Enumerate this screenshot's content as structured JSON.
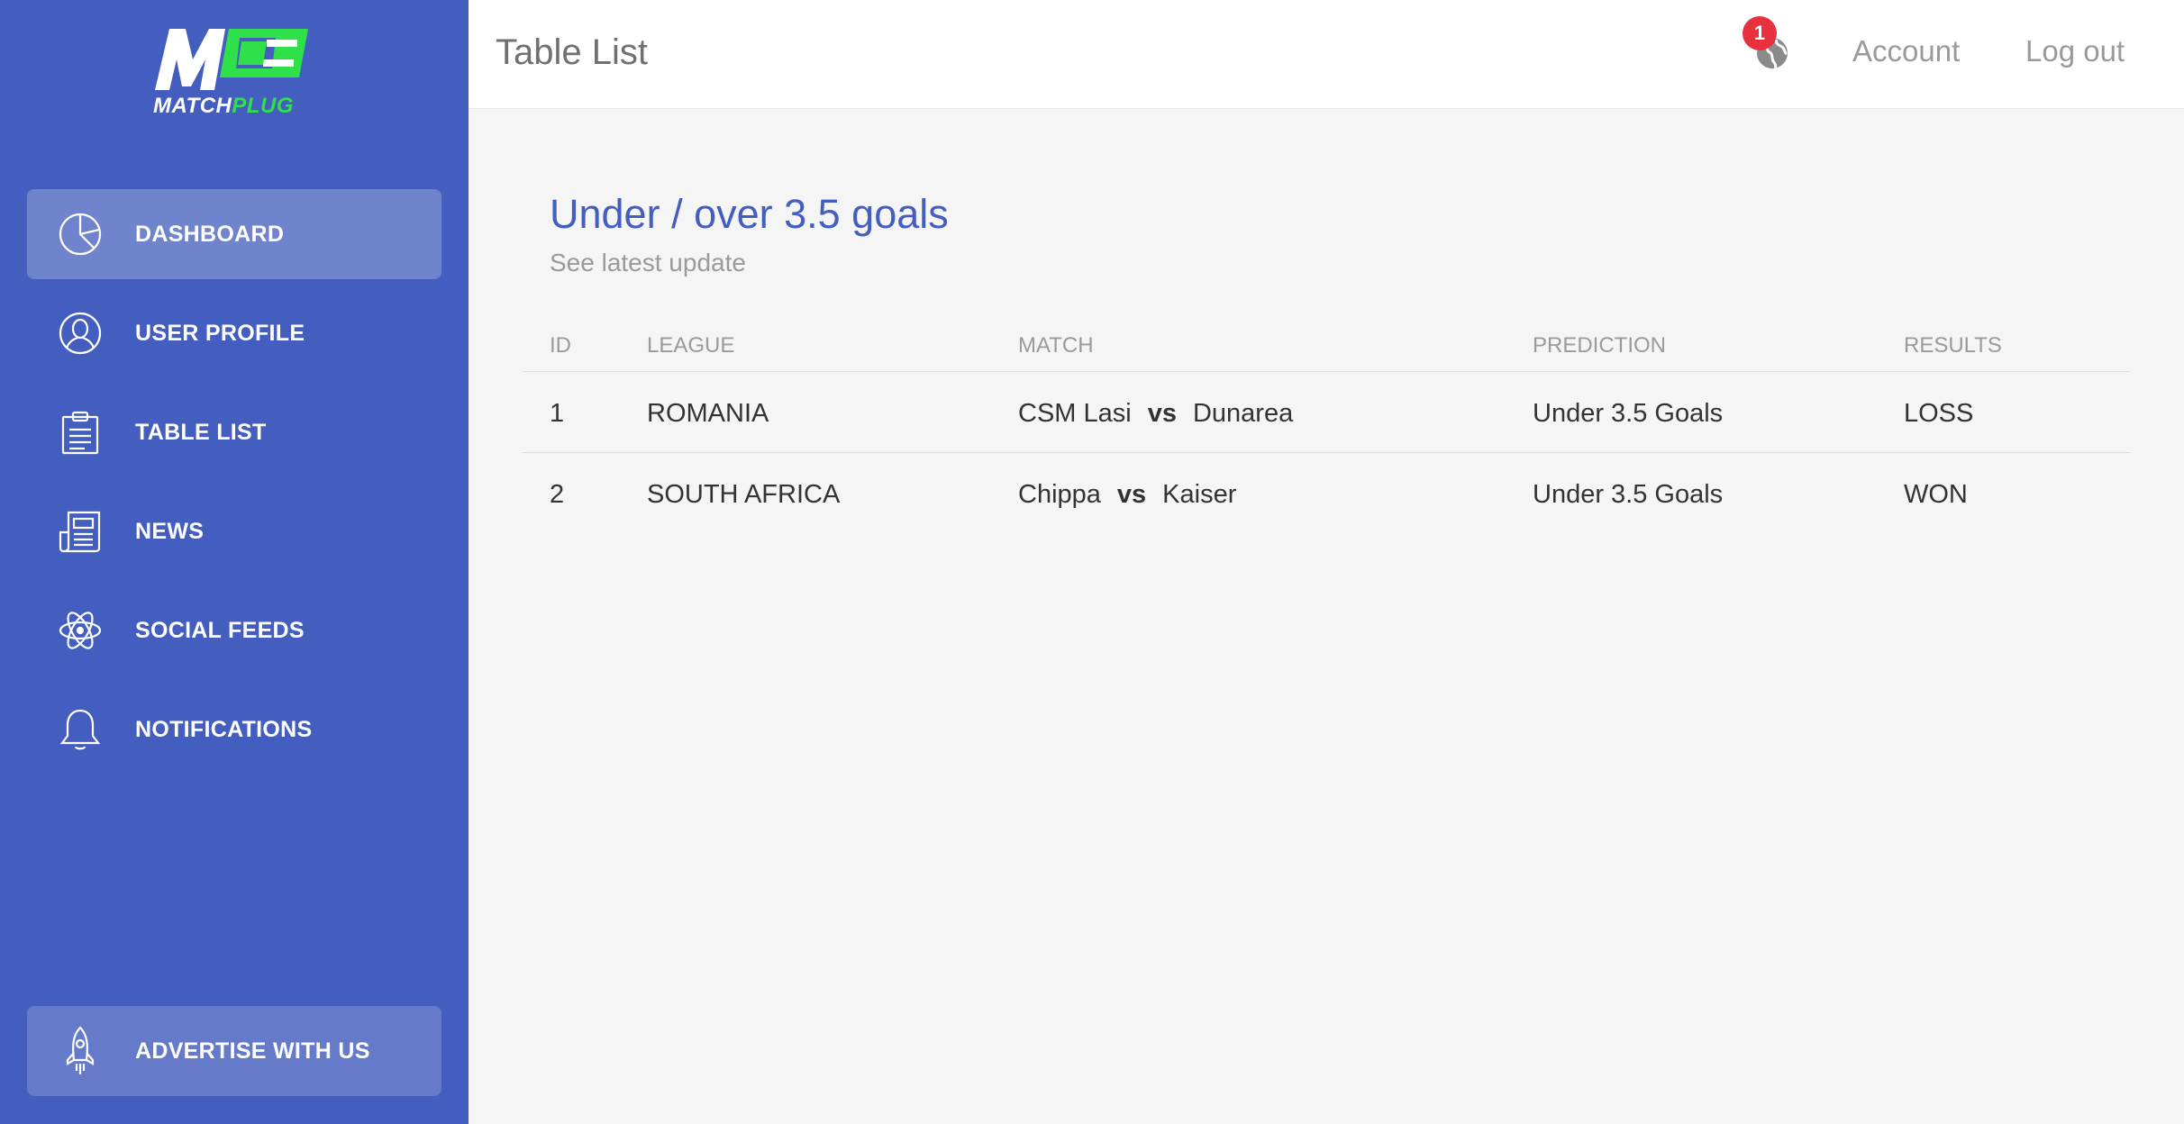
{
  "brand": {
    "name_white": "MATCH",
    "name_green": "PLUG",
    "green": "#2fe04a",
    "sidebar_color": "#445ebf"
  },
  "sidebar": {
    "items": [
      {
        "label": "DASHBOARD",
        "icon": "pie-chart-icon",
        "active": true
      },
      {
        "label": "USER PROFILE",
        "icon": "user-icon"
      },
      {
        "label": "TABLE LIST",
        "icon": "clipboard-icon"
      },
      {
        "label": "NEWS",
        "icon": "newspaper-icon"
      },
      {
        "label": "SOCIAL FEEDS",
        "icon": "atom-icon"
      },
      {
        "label": "NOTIFICATIONS",
        "icon": "bell-icon"
      }
    ],
    "advertise": {
      "label": "ADVERTISE WITH US",
      "icon": "rocket-icon"
    }
  },
  "header": {
    "title": "Table List",
    "notifications_count": "1",
    "account": "Account",
    "logout": "Log out"
  },
  "card": {
    "title": "Under / over 3.5 goals",
    "subtitle": "See latest update"
  },
  "table": {
    "columns": [
      "ID",
      "LEAGUE",
      "MATCH",
      "PREDICTION",
      "RESULTS"
    ],
    "rows": [
      {
        "id": "1",
        "league": "ROMANIA",
        "home": "CSM Lasi",
        "vs": "vs",
        "away": "Dunarea",
        "prediction": "Under 3.5 Goals",
        "result": "LOSS"
      },
      {
        "id": "2",
        "league": "SOUTH AFRICA",
        "home": "Chippa",
        "vs": "vs",
        "away": "Kaiser",
        "prediction": "Under 3.5 Goals",
        "result": "WON"
      }
    ]
  }
}
